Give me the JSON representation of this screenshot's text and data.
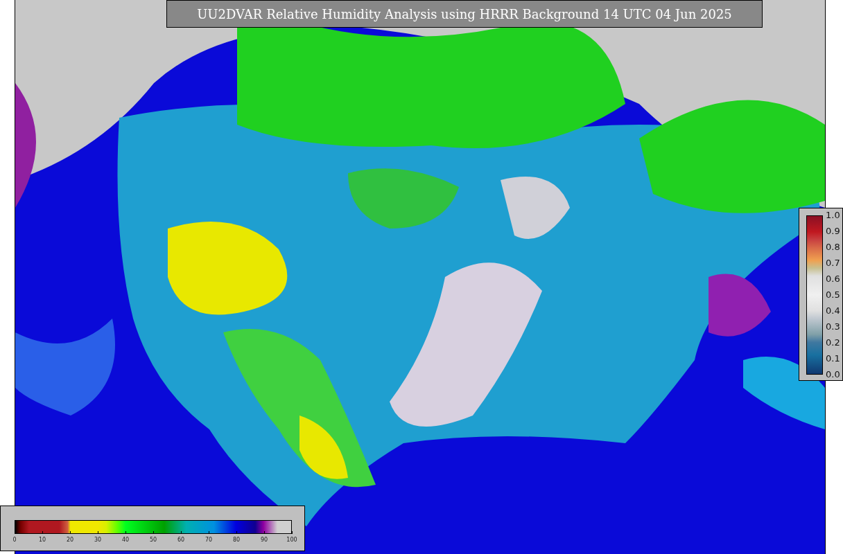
{
  "title": "UU2DVAR Relative Humidity Analysis using HRRR Background 14 UTC 04 Jun 2025",
  "humidity_colorbar": {
    "ticks": [
      "0",
      "10",
      "20",
      "30",
      "40",
      "50",
      "60",
      "70",
      "80",
      "90",
      "100"
    ]
  },
  "observation_colorbar": {
    "ticks": [
      "1.0",
      "0.9",
      "0.8",
      "0.7",
      "0.6",
      "0.5",
      "0.4",
      "0.3",
      "0.2",
      "0.1",
      "0.0"
    ]
  }
}
